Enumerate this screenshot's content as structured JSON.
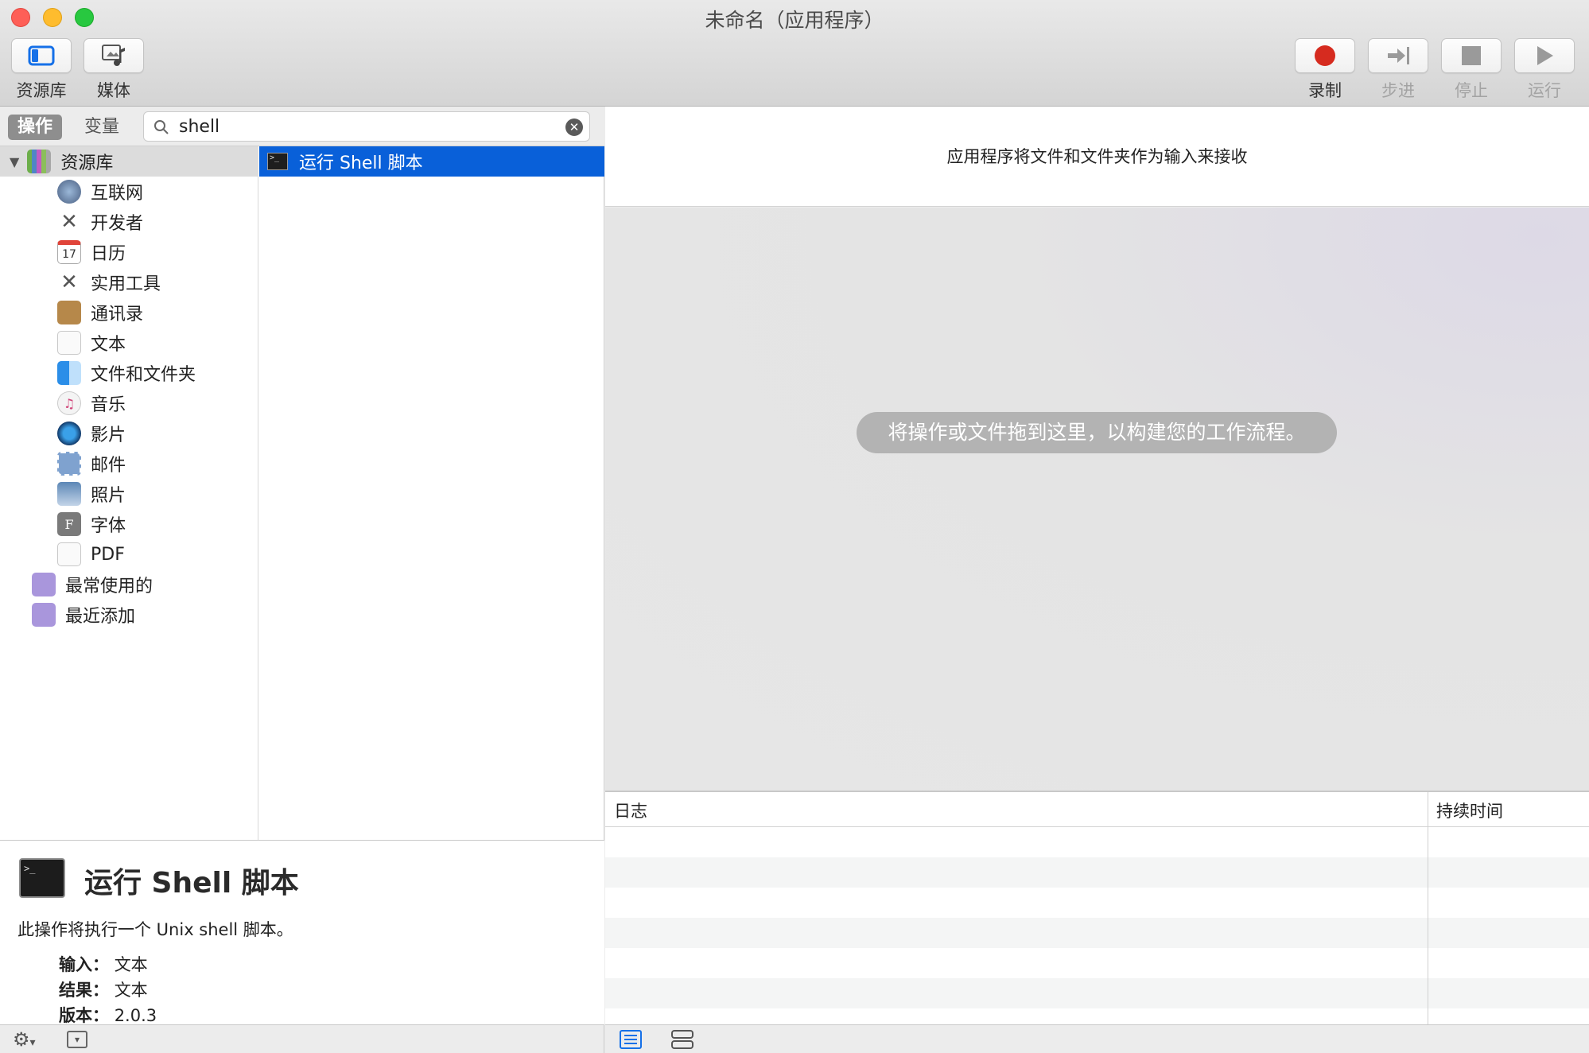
{
  "window": {
    "title": "未命名（应用程序）"
  },
  "toolbar": {
    "left": [
      {
        "label": "资源库",
        "icon": "library-icon"
      },
      {
        "label": "媒体",
        "icon": "media-icon"
      }
    ],
    "right": [
      {
        "label": "录制",
        "icon": "record-icon",
        "enabled": true
      },
      {
        "label": "步进",
        "icon": "step-icon",
        "enabled": false
      },
      {
        "label": "停止",
        "icon": "stop-icon",
        "enabled": false
      },
      {
        "label": "运行",
        "icon": "run-icon",
        "enabled": false
      }
    ]
  },
  "left_panel": {
    "tabs": [
      {
        "label": "操作",
        "active": true
      },
      {
        "label": "变量",
        "active": false
      }
    ],
    "search": {
      "value": "shell"
    },
    "library": {
      "root": "资源库",
      "categories": [
        "互联网",
        "开发者",
        "日历",
        "实用工具",
        "通讯录",
        "文本",
        "文件和文件夹",
        "音乐",
        "影片",
        "邮件",
        "照片",
        "字体",
        "PDF"
      ],
      "smart_groups": [
        "最常使用的",
        "最近添加"
      ]
    },
    "actions": [
      {
        "label": "运行 Shell 脚本",
        "selected": true
      }
    ],
    "description": {
      "title": "运行 Shell 脚本",
      "text": "此操作将执行一个 Unix shell 脚本。",
      "input_label": "输入：",
      "input_value": "文本",
      "result_label": "结果：",
      "result_value": "文本",
      "version_label": "版本：",
      "version_value": "2.0.3"
    }
  },
  "workflow": {
    "input_header": "应用程序将文件和文件夹作为输入来接收",
    "hint": "将操作或文件拖到这里，以构建您的工作流程。",
    "log": {
      "col_log": "日志",
      "col_duration": "持续时间"
    }
  },
  "colors": {
    "selection": "#0960d9",
    "record": "#d62b1f"
  }
}
